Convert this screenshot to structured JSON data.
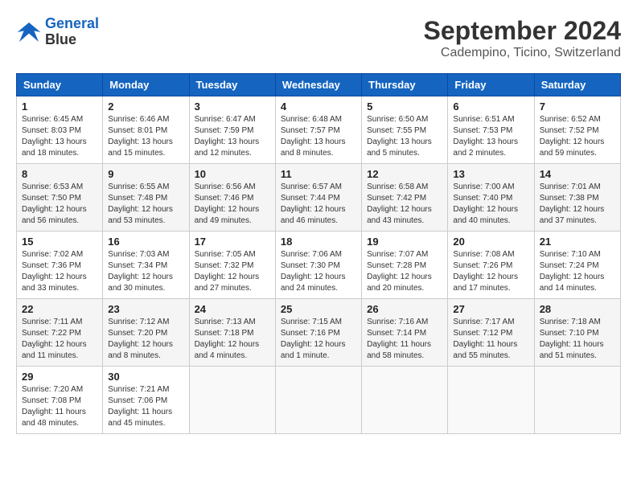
{
  "logo": {
    "line1": "General",
    "line2": "Blue"
  },
  "title": "September 2024",
  "subtitle": "Cadempino, Ticino, Switzerland",
  "weekdays": [
    "Sunday",
    "Monday",
    "Tuesday",
    "Wednesday",
    "Thursday",
    "Friday",
    "Saturday"
  ],
  "weeks": [
    [
      {
        "day": "1",
        "sunrise": "6:45 AM",
        "sunset": "8:03 PM",
        "daylight": "13 hours and 18 minutes."
      },
      {
        "day": "2",
        "sunrise": "6:46 AM",
        "sunset": "8:01 PM",
        "daylight": "13 hours and 15 minutes."
      },
      {
        "day": "3",
        "sunrise": "6:47 AM",
        "sunset": "7:59 PM",
        "daylight": "13 hours and 12 minutes."
      },
      {
        "day": "4",
        "sunrise": "6:48 AM",
        "sunset": "7:57 PM",
        "daylight": "13 hours and 8 minutes."
      },
      {
        "day": "5",
        "sunrise": "6:50 AM",
        "sunset": "7:55 PM",
        "daylight": "13 hours and 5 minutes."
      },
      {
        "day": "6",
        "sunrise": "6:51 AM",
        "sunset": "7:53 PM",
        "daylight": "13 hours and 2 minutes."
      },
      {
        "day": "7",
        "sunrise": "6:52 AM",
        "sunset": "7:52 PM",
        "daylight": "12 hours and 59 minutes."
      }
    ],
    [
      {
        "day": "8",
        "sunrise": "6:53 AM",
        "sunset": "7:50 PM",
        "daylight": "12 hours and 56 minutes."
      },
      {
        "day": "9",
        "sunrise": "6:55 AM",
        "sunset": "7:48 PM",
        "daylight": "12 hours and 53 minutes."
      },
      {
        "day": "10",
        "sunrise": "6:56 AM",
        "sunset": "7:46 PM",
        "daylight": "12 hours and 49 minutes."
      },
      {
        "day": "11",
        "sunrise": "6:57 AM",
        "sunset": "7:44 PM",
        "daylight": "12 hours and 46 minutes."
      },
      {
        "day": "12",
        "sunrise": "6:58 AM",
        "sunset": "7:42 PM",
        "daylight": "12 hours and 43 minutes."
      },
      {
        "day": "13",
        "sunrise": "7:00 AM",
        "sunset": "7:40 PM",
        "daylight": "12 hours and 40 minutes."
      },
      {
        "day": "14",
        "sunrise": "7:01 AM",
        "sunset": "7:38 PM",
        "daylight": "12 hours and 37 minutes."
      }
    ],
    [
      {
        "day": "15",
        "sunrise": "7:02 AM",
        "sunset": "7:36 PM",
        "daylight": "12 hours and 33 minutes."
      },
      {
        "day": "16",
        "sunrise": "7:03 AM",
        "sunset": "7:34 PM",
        "daylight": "12 hours and 30 minutes."
      },
      {
        "day": "17",
        "sunrise": "7:05 AM",
        "sunset": "7:32 PM",
        "daylight": "12 hours and 27 minutes."
      },
      {
        "day": "18",
        "sunrise": "7:06 AM",
        "sunset": "7:30 PM",
        "daylight": "12 hours and 24 minutes."
      },
      {
        "day": "19",
        "sunrise": "7:07 AM",
        "sunset": "7:28 PM",
        "daylight": "12 hours and 20 minutes."
      },
      {
        "day": "20",
        "sunrise": "7:08 AM",
        "sunset": "7:26 PM",
        "daylight": "12 hours and 17 minutes."
      },
      {
        "day": "21",
        "sunrise": "7:10 AM",
        "sunset": "7:24 PM",
        "daylight": "12 hours and 14 minutes."
      }
    ],
    [
      {
        "day": "22",
        "sunrise": "7:11 AM",
        "sunset": "7:22 PM",
        "daylight": "12 hours and 11 minutes."
      },
      {
        "day": "23",
        "sunrise": "7:12 AM",
        "sunset": "7:20 PM",
        "daylight": "12 hours and 8 minutes."
      },
      {
        "day": "24",
        "sunrise": "7:13 AM",
        "sunset": "7:18 PM",
        "daylight": "12 hours and 4 minutes."
      },
      {
        "day": "25",
        "sunrise": "7:15 AM",
        "sunset": "7:16 PM",
        "daylight": "12 hours and 1 minute."
      },
      {
        "day": "26",
        "sunrise": "7:16 AM",
        "sunset": "7:14 PM",
        "daylight": "11 hours and 58 minutes."
      },
      {
        "day": "27",
        "sunrise": "7:17 AM",
        "sunset": "7:12 PM",
        "daylight": "11 hours and 55 minutes."
      },
      {
        "day": "28",
        "sunrise": "7:18 AM",
        "sunset": "7:10 PM",
        "daylight": "11 hours and 51 minutes."
      }
    ],
    [
      {
        "day": "29",
        "sunrise": "7:20 AM",
        "sunset": "7:08 PM",
        "daylight": "11 hours and 48 minutes."
      },
      {
        "day": "30",
        "sunrise": "7:21 AM",
        "sunset": "7:06 PM",
        "daylight": "11 hours and 45 minutes."
      },
      null,
      null,
      null,
      null,
      null
    ]
  ]
}
